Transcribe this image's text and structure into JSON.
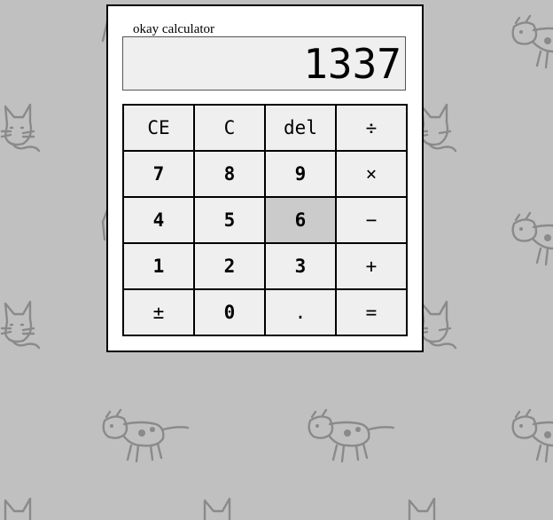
{
  "window": {
    "title": "okay calculator"
  },
  "display": {
    "value": "1337"
  },
  "keys": [
    {
      "label": "CE",
      "name": "clear-entry-button",
      "type": "func"
    },
    {
      "label": "C",
      "name": "clear-button",
      "type": "func"
    },
    {
      "label": "del",
      "name": "delete-button",
      "type": "func"
    },
    {
      "label": "÷",
      "name": "divide-button",
      "type": "op"
    },
    {
      "label": "7",
      "name": "digit-7-button",
      "type": "digit"
    },
    {
      "label": "8",
      "name": "digit-8-button",
      "type": "digit"
    },
    {
      "label": "9",
      "name": "digit-9-button",
      "type": "digit"
    },
    {
      "label": "×",
      "name": "multiply-button",
      "type": "op"
    },
    {
      "label": "4",
      "name": "digit-4-button",
      "type": "digit"
    },
    {
      "label": "5",
      "name": "digit-5-button",
      "type": "digit"
    },
    {
      "label": "6",
      "name": "digit-6-button",
      "type": "digit",
      "pressed": true
    },
    {
      "label": "−",
      "name": "subtract-button",
      "type": "op"
    },
    {
      "label": "1",
      "name": "digit-1-button",
      "type": "digit"
    },
    {
      "label": "2",
      "name": "digit-2-button",
      "type": "digit"
    },
    {
      "label": "3",
      "name": "digit-3-button",
      "type": "digit"
    },
    {
      "label": "+",
      "name": "add-button",
      "type": "op"
    },
    {
      "label": "±",
      "name": "negate-button",
      "type": "op"
    },
    {
      "label": "0",
      "name": "digit-0-button",
      "type": "digit"
    },
    {
      "label": ".",
      "name": "decimal-point-button",
      "type": "op"
    },
    {
      "label": "=",
      "name": "equals-button",
      "type": "op"
    }
  ],
  "background": {
    "color": "#c0c0c0",
    "doodle_color": "#8a8a8a",
    "pattern": [
      "cat-doodle",
      "cow-doodle"
    ]
  }
}
